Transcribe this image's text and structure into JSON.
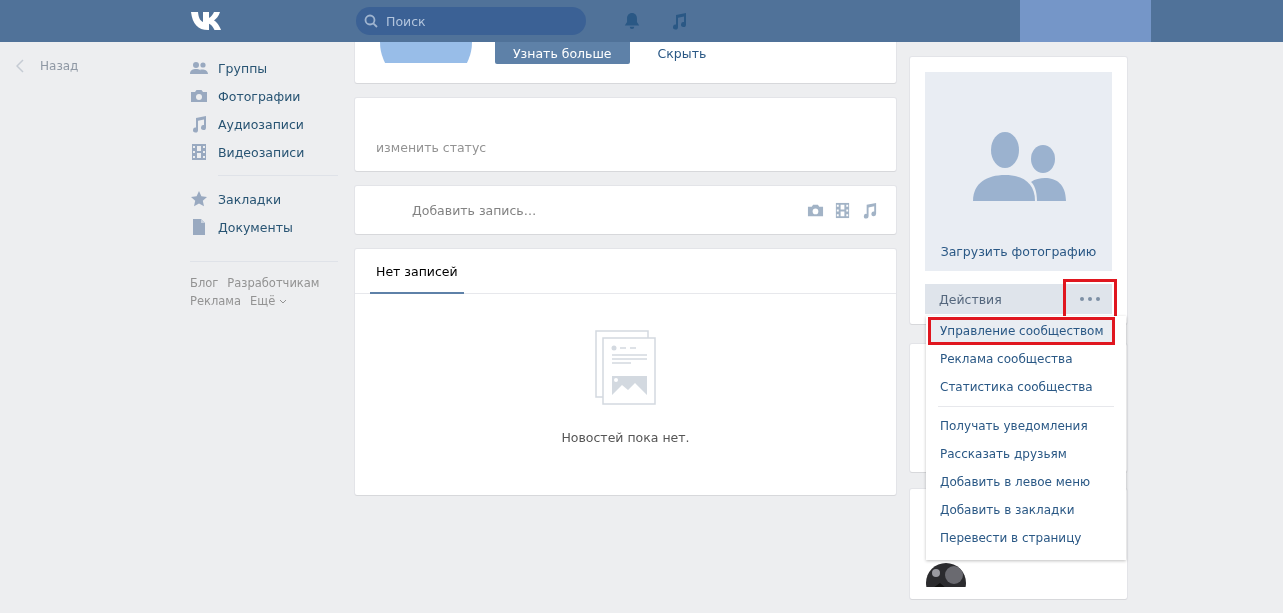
{
  "header": {
    "search": {
      "placeholder": "Поиск"
    }
  },
  "back_link": "Назад",
  "sidebar": {
    "items": [
      {
        "label": "Группы",
        "kind": "groups"
      },
      {
        "label": "Фотографии",
        "kind": "camera"
      },
      {
        "label": "Аудиозаписи",
        "kind": "note"
      },
      {
        "label": "Видеозаписи",
        "kind": "film"
      }
    ],
    "more_items": [
      {
        "label": "Закладки",
        "kind": "star"
      },
      {
        "label": "Документы",
        "kind": "document"
      }
    ],
    "footer_links": [
      "Блог",
      "Разработчикам",
      "Реклама",
      "Ещё"
    ]
  },
  "promo": {
    "primary_button": "Узнать больше",
    "secondary_button": "Скрыть"
  },
  "status": {
    "link": "изменить статус"
  },
  "composer": {
    "placeholder": "Добавить запись…"
  },
  "wall": {
    "tabs": [
      {
        "label": "Нет записей",
        "selected": true
      }
    ],
    "empty_text": "Новостей пока нет."
  },
  "cover": {
    "upload_label": "Загрузить фотографию"
  },
  "actions": {
    "label": "Действия",
    "more_highlighted": true,
    "menu": [
      {
        "label": "Управление сообществом",
        "highlighted": true,
        "divider_before": false
      },
      {
        "label": "Реклама сообщества",
        "highlighted": false,
        "divider_before": false
      },
      {
        "label": "Статистика сообщества",
        "highlighted": false,
        "divider_before": false
      },
      {
        "label": "Получать уведомления",
        "highlighted": false,
        "divider_before": true
      },
      {
        "label": "Рассказать друзьям",
        "highlighted": false,
        "divider_before": false
      },
      {
        "label": "Добавить в левое меню",
        "highlighted": false,
        "divider_before": false
      },
      {
        "label": "Добавить в закладки",
        "highlighted": false,
        "divider_before": false
      },
      {
        "label": "Перевести в страницу",
        "highlighted": false,
        "divider_before": false
      }
    ]
  }
}
